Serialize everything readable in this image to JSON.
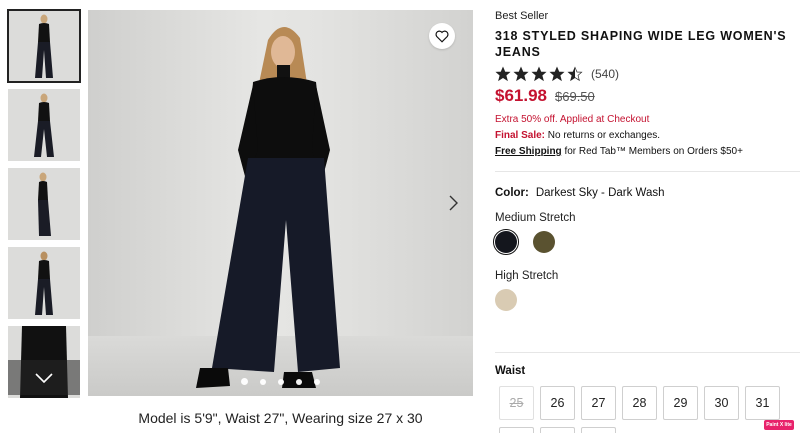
{
  "gallery": {
    "thumbnails": [
      {
        "alt": "front view",
        "active": true
      },
      {
        "alt": "front view 2",
        "active": false
      },
      {
        "alt": "side view",
        "active": false
      },
      {
        "alt": "back view",
        "active": false
      },
      {
        "alt": "detail view",
        "active": false
      }
    ],
    "caption": "Model is 5'9\", Waist 27\", Wearing size 27 x 30",
    "dots_count": 5,
    "active_dot": 0
  },
  "product": {
    "badge": "Best Seller",
    "title": "318 STYLED SHAPING WIDE LEG WOMEN'S JEANS",
    "rating": 4.5,
    "review_count": "(540)",
    "price": "$61.98",
    "original_price": "$69.50",
    "promo": "Extra 50% off. Applied at Checkout",
    "final_sale_label": "Final Sale:",
    "final_sale_text": " No returns or exchanges.",
    "shipping_label": "Free Shipping",
    "shipping_text": " for Red Tab™ Members on Orders $50+"
  },
  "color": {
    "label": "Color:",
    "value": "Darkest Sky - Dark Wash",
    "groups": [
      {
        "name": "Medium Stretch",
        "swatches": [
          {
            "color": "#14161d",
            "selected": true
          },
          {
            "color": "#5a5230",
            "selected": false
          }
        ]
      },
      {
        "name": "High Stretch",
        "swatches": [
          {
            "color": "#d9cbb3",
            "selected": false
          }
        ]
      }
    ]
  },
  "waist": {
    "label": "Waist",
    "sizes": [
      {
        "value": "25",
        "available": false
      },
      {
        "value": "26",
        "available": true
      },
      {
        "value": "27",
        "available": true
      },
      {
        "value": "28",
        "available": true
      },
      {
        "value": "29",
        "available": true
      },
      {
        "value": "30",
        "available": true
      },
      {
        "value": "31",
        "available": true
      }
    ]
  },
  "extension_badge": "Paint X lite",
  "colors": {
    "accent": "#c41230",
    "text": "#111111"
  }
}
